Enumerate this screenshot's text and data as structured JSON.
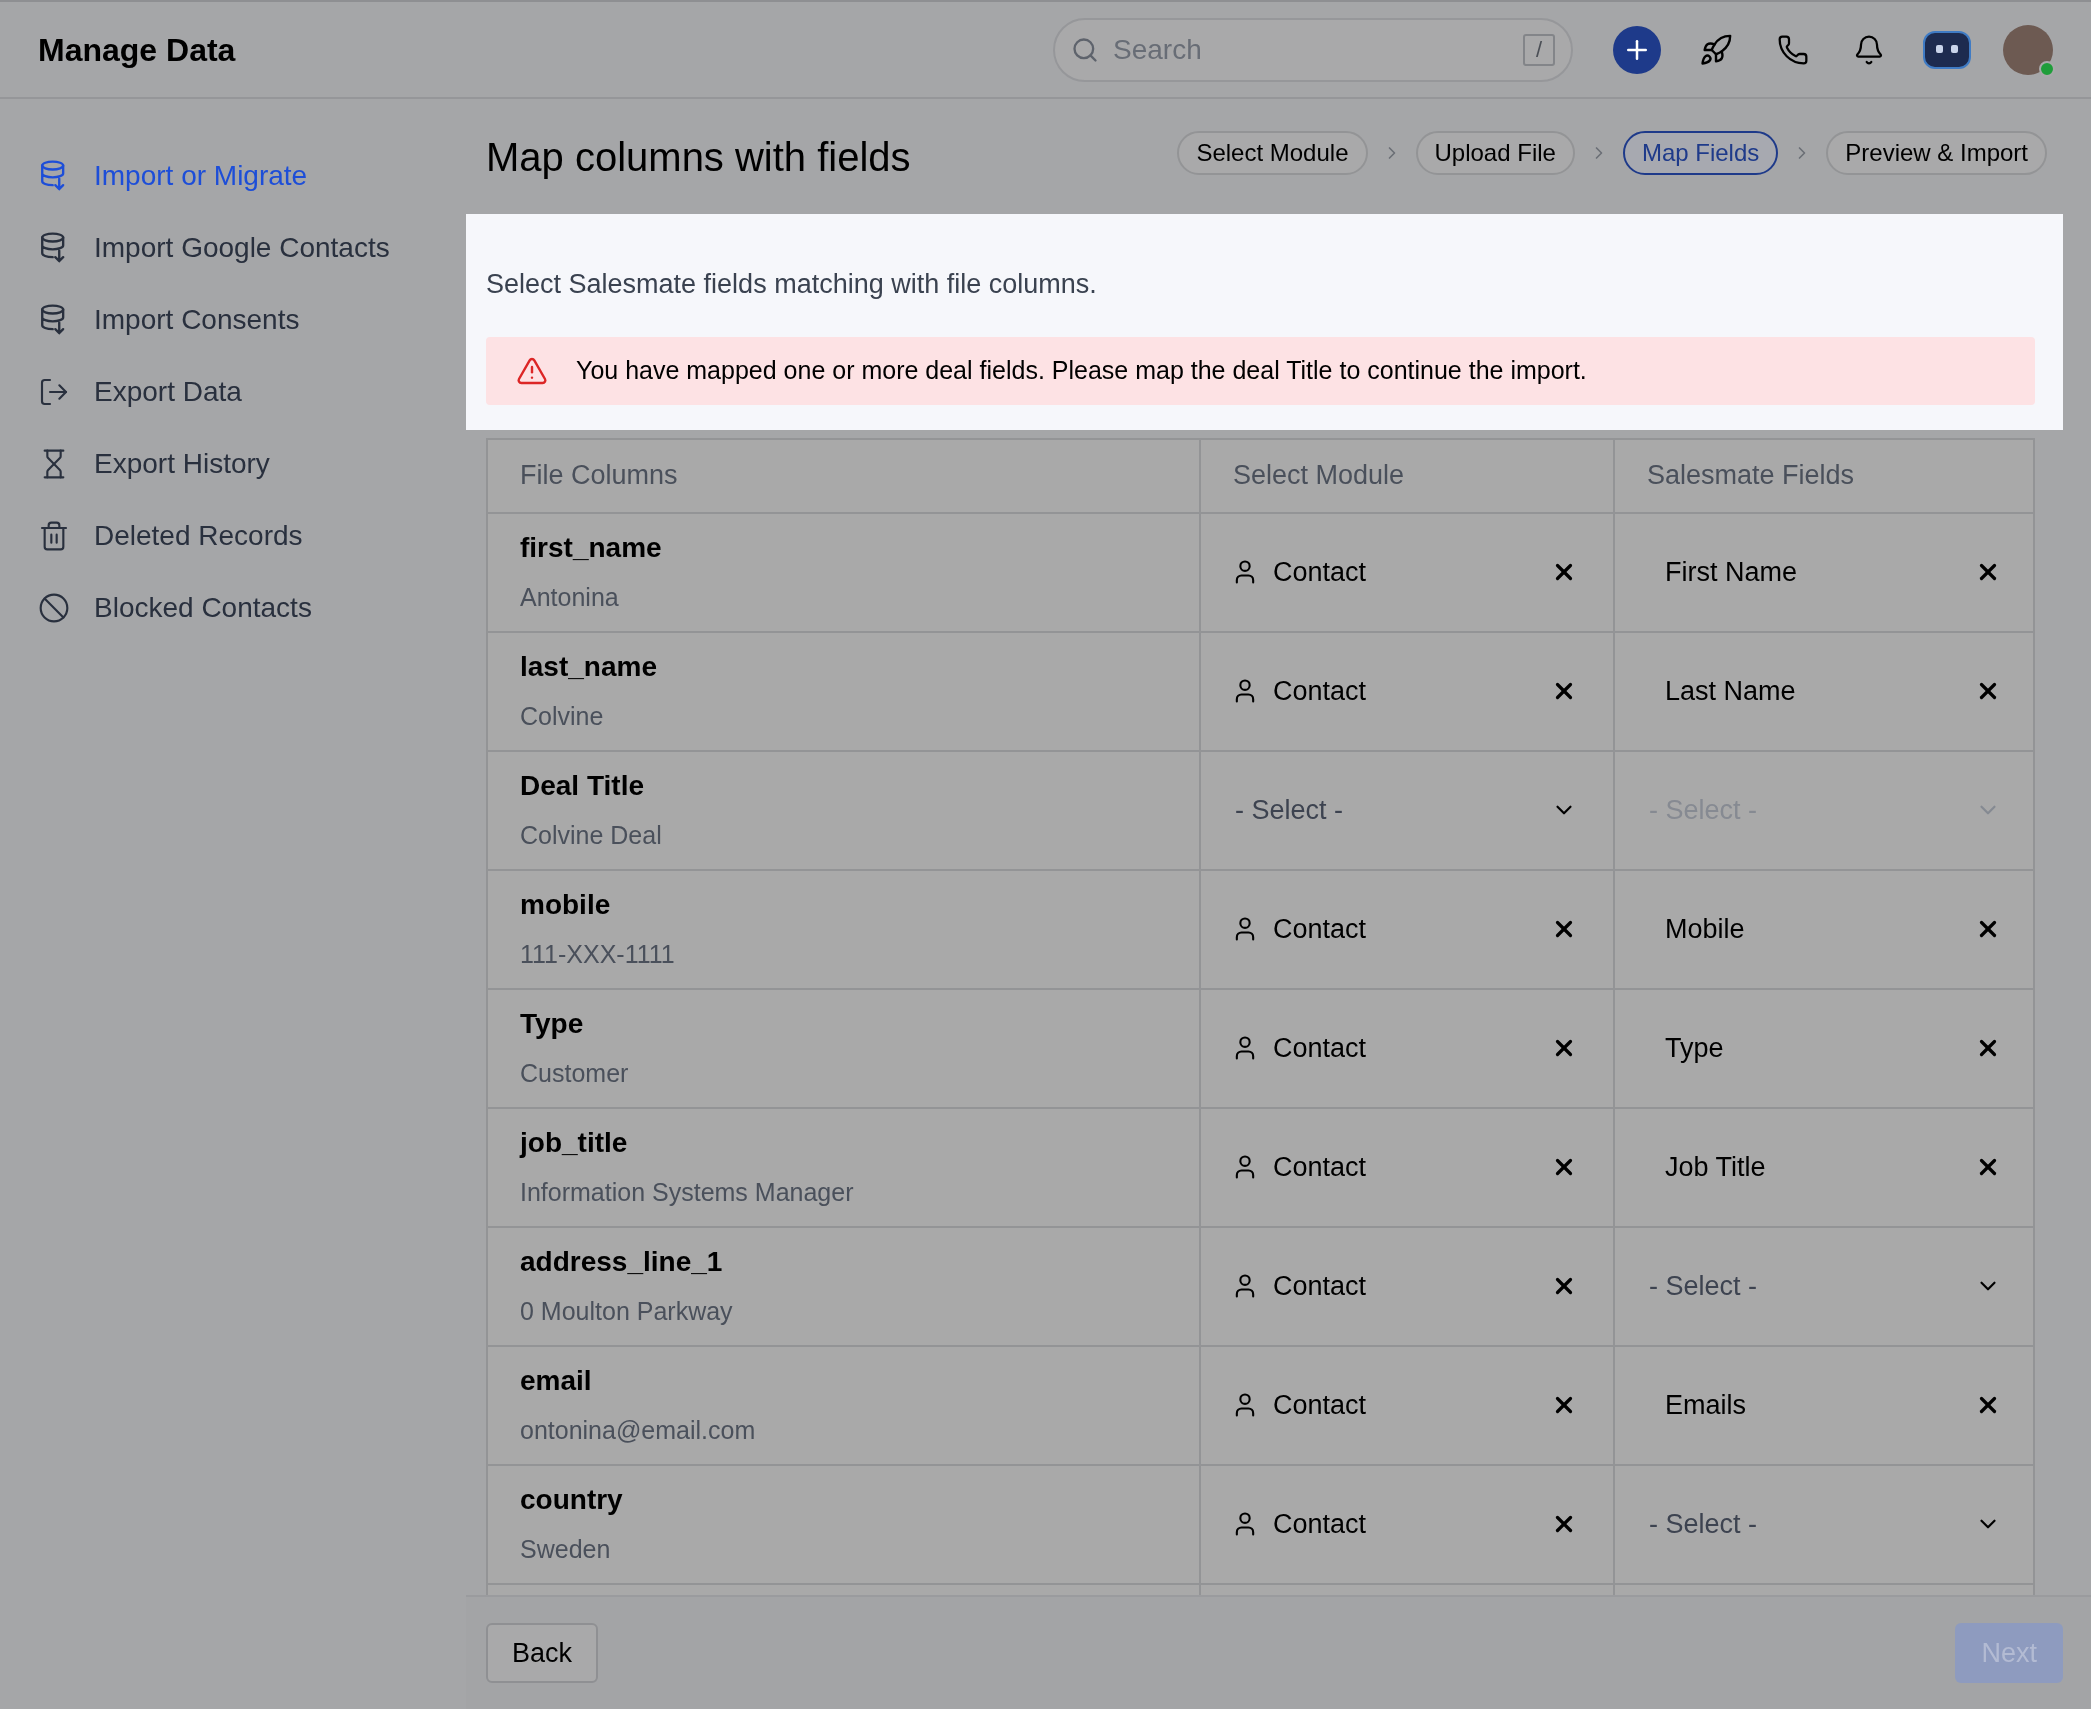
{
  "header": {
    "title": "Manage Data",
    "search": {
      "placeholder": "Search",
      "shortcut": "/"
    }
  },
  "sidebar": {
    "items": [
      {
        "label": "Import or Migrate",
        "selected": true
      },
      {
        "label": "Import Google Contacts",
        "selected": false
      },
      {
        "label": "Import Consents",
        "selected": false
      },
      {
        "label": "Export Data",
        "selected": false
      },
      {
        "label": "Export History",
        "selected": false
      },
      {
        "label": "Deleted Records",
        "selected": false
      },
      {
        "label": "Blocked Contacts",
        "selected": false
      }
    ]
  },
  "page": {
    "title": "Map columns with fields",
    "steps": [
      {
        "label": "Select Module",
        "selected": false
      },
      {
        "label": "Upload File",
        "selected": false
      },
      {
        "label": "Map Fields",
        "selected": true
      },
      {
        "label": "Preview & Import",
        "selected": false
      }
    ]
  },
  "notice": {
    "text": "Select Salesmate fields matching with file columns.",
    "alert": "You have mapped one or more deal fields. Please map the deal Title to continue the import."
  },
  "table": {
    "columns": [
      "File Columns",
      "Select Module",
      "Salesmate Fields"
    ],
    "rows": [
      {
        "column": "first_name",
        "sample": "Antonina",
        "module": {
          "value": "Contact"
        },
        "field": {
          "value": "First Name"
        }
      },
      {
        "column": "last_name",
        "sample": "Colvine",
        "module": {
          "value": "Contact"
        },
        "field": {
          "value": "Last Name"
        }
      },
      {
        "column": "Deal Title",
        "sample": "Colvine Deal",
        "module": {
          "placeholder": "- Select -"
        },
        "field": {
          "placeholder": "- Select -",
          "disabled": true
        }
      },
      {
        "column": "mobile",
        "sample": "111-XXX-1111",
        "module": {
          "value": "Contact"
        },
        "field": {
          "value": "Mobile"
        }
      },
      {
        "column": "Type",
        "sample": "Customer",
        "module": {
          "value": "Contact"
        },
        "field": {
          "value": "Type"
        }
      },
      {
        "column": "job_title",
        "sample": "Information Systems Manager",
        "module": {
          "value": "Contact"
        },
        "field": {
          "value": "Job Title"
        }
      },
      {
        "column": "address_line_1",
        "sample": "0 Moulton Parkway",
        "module": {
          "value": "Contact"
        },
        "field": {
          "placeholder": "- Select -",
          "disabled": false
        }
      },
      {
        "column": "email",
        "sample": "ontonina@email.com",
        "module": {
          "value": "Contact"
        },
        "field": {
          "value": "Emails"
        }
      },
      {
        "column": "country",
        "sample": "Sweden",
        "module": {
          "value": "Contact"
        },
        "field": {
          "placeholder": "- Select -",
          "disabled": false
        }
      }
    ]
  },
  "footer": {
    "back": "Back",
    "next": {
      "label": "Next",
      "disabled": true
    }
  }
}
